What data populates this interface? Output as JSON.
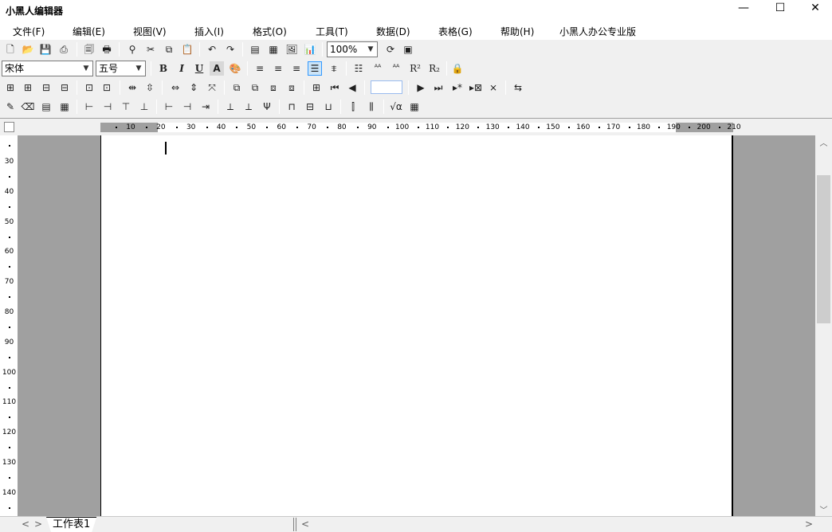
{
  "window": {
    "title": "小黑人编辑器",
    "minimize_glyph": "—",
    "maximize_glyph": "☐",
    "close_glyph": "✕"
  },
  "menu": {
    "items": [
      {
        "label": "文件(F)"
      },
      {
        "label": "编辑(E)"
      },
      {
        "label": "视图(V)"
      },
      {
        "label": "插入(I)"
      },
      {
        "label": "格式(O)"
      },
      {
        "label": "工具(T)"
      },
      {
        "label": "数据(D)"
      },
      {
        "label": "表格(G)"
      },
      {
        "label": "帮助(H)"
      },
      {
        "label": "小黑人办公专业版"
      }
    ]
  },
  "toolbar1": {
    "icons": [
      {
        "name": "new-document-icon",
        "glyph": "🗋"
      },
      {
        "name": "open-folder-icon",
        "glyph": "📂"
      },
      {
        "name": "save-icon",
        "glyph": "💾"
      },
      {
        "name": "print-icon",
        "glyph": "⎙"
      },
      {
        "name": "print-preview-icon",
        "glyph": "🗐"
      },
      {
        "name": "printer-icon",
        "glyph": "🖶"
      },
      {
        "name": "find-binoculars-icon",
        "glyph": "⚲"
      },
      {
        "name": "cut-scissors-icon",
        "glyph": "✂"
      },
      {
        "name": "copy-icon",
        "glyph": "⧉"
      },
      {
        "name": "paste-icon",
        "glyph": "📋"
      },
      {
        "name": "undo-icon",
        "glyph": "↶"
      },
      {
        "name": "redo-icon",
        "glyph": "↷"
      },
      {
        "name": "insert-textbox-icon",
        "glyph": "▤"
      },
      {
        "name": "insert-table-icon",
        "glyph": "▦"
      },
      {
        "name": "insert-image-icon",
        "glyph": "🖼"
      },
      {
        "name": "insert-chart-icon",
        "glyph": "📊"
      },
      {
        "name": "refresh-icon",
        "glyph": "⟳"
      },
      {
        "name": "page-setup-icon",
        "glyph": "▣"
      }
    ],
    "zoom": {
      "value": "100%"
    }
  },
  "toolbar2": {
    "font_name": "宋体",
    "font_size": "五号",
    "icons": [
      {
        "name": "bold-icon",
        "glyph": "B"
      },
      {
        "name": "italic-icon",
        "glyph": "I"
      },
      {
        "name": "underline-icon",
        "glyph": "U"
      },
      {
        "name": "font-shadow-icon",
        "glyph": "A"
      },
      {
        "name": "color-palette-icon",
        "glyph": "🎨"
      },
      {
        "name": "align-left-icon",
        "glyph": "≡"
      },
      {
        "name": "align-center-icon",
        "glyph": "≡"
      },
      {
        "name": "align-right-icon",
        "glyph": "≡"
      },
      {
        "name": "justify-icon",
        "glyph": "☰"
      },
      {
        "name": "distributed-align-icon",
        "glyph": "⩨"
      },
      {
        "name": "line-spacing-icon",
        "glyph": "☷"
      },
      {
        "name": "character-spacing-icon",
        "glyph": "ᴬᴬ"
      },
      {
        "name": "character-scale-icon",
        "glyph": "ᴬᴬ"
      },
      {
        "name": "superscript-icon",
        "glyph": "R²"
      },
      {
        "name": "subscript-icon",
        "glyph": "R₂"
      },
      {
        "name": "lock-icon",
        "glyph": "🔒"
      }
    ]
  },
  "toolbar3": {
    "icons": [
      {
        "name": "insert-row-above-icon",
        "glyph": "⊞"
      },
      {
        "name": "insert-row-below-icon",
        "glyph": "⊞"
      },
      {
        "name": "insert-column-left-icon",
        "glyph": "⊟"
      },
      {
        "name": "insert-column-right-icon",
        "glyph": "⊟"
      },
      {
        "name": "merge-cells-icon",
        "glyph": "⊡"
      },
      {
        "name": "split-cells-icon",
        "glyph": "⊡"
      },
      {
        "name": "distribute-columns-icon",
        "glyph": "⇹"
      },
      {
        "name": "distribute-rows-icon",
        "glyph": "⇳"
      },
      {
        "name": "fit-width-icon",
        "glyph": "⇔"
      },
      {
        "name": "fit-height-icon",
        "glyph": "⇕"
      },
      {
        "name": "fit-cell-icon",
        "glyph": "⤧"
      },
      {
        "name": "bring-front-icon",
        "glyph": "⧉"
      },
      {
        "name": "send-back-icon",
        "glyph": "⧉"
      },
      {
        "name": "bring-forward-icon",
        "glyph": "⧈"
      },
      {
        "name": "send-backward-icon",
        "glyph": "⧈"
      },
      {
        "name": "new-record-icon",
        "glyph": "⊞"
      },
      {
        "name": "first-record-icon",
        "glyph": "⏮"
      },
      {
        "name": "previous-record-icon",
        "glyph": "◀"
      },
      {
        "name": "next-record-icon",
        "glyph": "▶"
      },
      {
        "name": "last-record-icon",
        "glyph": "⏭"
      },
      {
        "name": "append-record-icon",
        "glyph": "▸*"
      },
      {
        "name": "delete-record-icon",
        "glyph": "▸⊠"
      },
      {
        "name": "clear-records-icon",
        "glyph": "⨯"
      },
      {
        "name": "data-source-icon",
        "glyph": "⇆"
      }
    ],
    "record_field_value": ""
  },
  "toolbar4": {
    "icons": [
      {
        "name": "pencil-draw-icon",
        "glyph": "✎"
      },
      {
        "name": "eraser-icon",
        "glyph": "⌫"
      },
      {
        "name": "table-layout-icon",
        "glyph": "▤"
      },
      {
        "name": "grid-table-icon",
        "glyph": "▦"
      },
      {
        "name": "tree-right-icon",
        "glyph": "⊢"
      },
      {
        "name": "tree-left-icon",
        "glyph": "⊣"
      },
      {
        "name": "tree-down-icon",
        "glyph": "⊤"
      },
      {
        "name": "tree-up-icon",
        "glyph": "⊥"
      },
      {
        "name": "branch-add-icon",
        "glyph": "⊢"
      },
      {
        "name": "branch-remove-icon",
        "glyph": "⊣"
      },
      {
        "name": "branch-arrow-icon",
        "glyph": "⇥"
      },
      {
        "name": "level-up-icon",
        "glyph": "⟂"
      },
      {
        "name": "level-down-icon",
        "glyph": "⟂"
      },
      {
        "name": "trident-icon",
        "glyph": "Ψ"
      },
      {
        "name": "header-frame-icon",
        "glyph": "⊓"
      },
      {
        "name": "middle-frame-icon",
        "glyph": "⊟"
      },
      {
        "name": "footer-frame-icon",
        "glyph": "⊔"
      },
      {
        "name": "column-split-icon",
        "glyph": "⫿"
      },
      {
        "name": "column-grid-icon",
        "glyph": "⫼"
      },
      {
        "name": "formula-sqrt-icon",
        "glyph": "√α"
      },
      {
        "name": "calculator-icon",
        "glyph": "▦"
      }
    ]
  },
  "ruler": {
    "horizontal_labels": [
      "10",
      "20",
      "30",
      "40",
      "50",
      "60",
      "70",
      "80",
      "90",
      "100",
      "110",
      "120",
      "130",
      "140",
      "150",
      "160",
      "170",
      "180",
      "190",
      "200",
      "210"
    ],
    "vertical_labels": [
      "30",
      "40",
      "50",
      "60",
      "70",
      "80",
      "90",
      "100",
      "110",
      "120",
      "130",
      "140"
    ]
  },
  "colors": {
    "workspace_gray": "#a0a0a0",
    "page_white": "#ffffff",
    "chrome": "#f0f0f0"
  },
  "sheet_tabs": {
    "prev_glyph": "<",
    "next_glyph": ">",
    "tabs": [
      {
        "label": "工作表1"
      }
    ]
  },
  "scrollbars": {
    "up_glyph": "︿",
    "down_glyph": "﹀",
    "left_glyph": "<",
    "right_glyph": ">"
  }
}
